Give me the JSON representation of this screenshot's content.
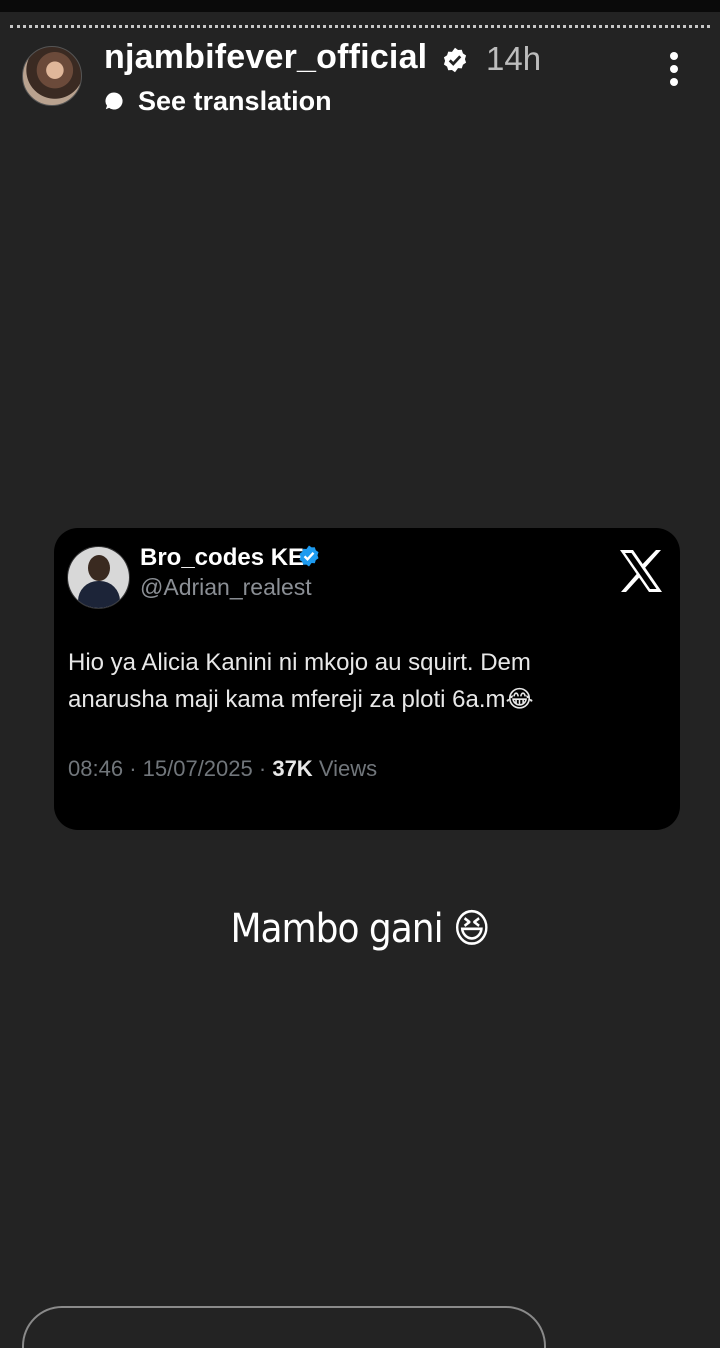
{
  "story": {
    "username": "njambifever_official",
    "time": "14h",
    "translate_label": "See translation",
    "icons": {
      "avatar": "profile-avatar",
      "verified": "verified-badge-icon",
      "translate": "speech-bubble-icon",
      "more": "more-vertical-icon"
    }
  },
  "tweet": {
    "name": "Bro_codes KE",
    "handle": "@Adrian_realest",
    "text_line1": "Hio ya Alicia Kanini ni mkojo au squirt. Dem",
    "text_line2": "anarusha maji kama mfereji za ploti 6a.m😂",
    "time": "08:46",
    "date": "15/07/2025",
    "separator": "·",
    "views_count": "37K",
    "views_label": "Views",
    "colors": {
      "verified": "#1d9bf0",
      "background": "#000000"
    }
  },
  "caption": {
    "text": "Mambo gani 😆"
  }
}
